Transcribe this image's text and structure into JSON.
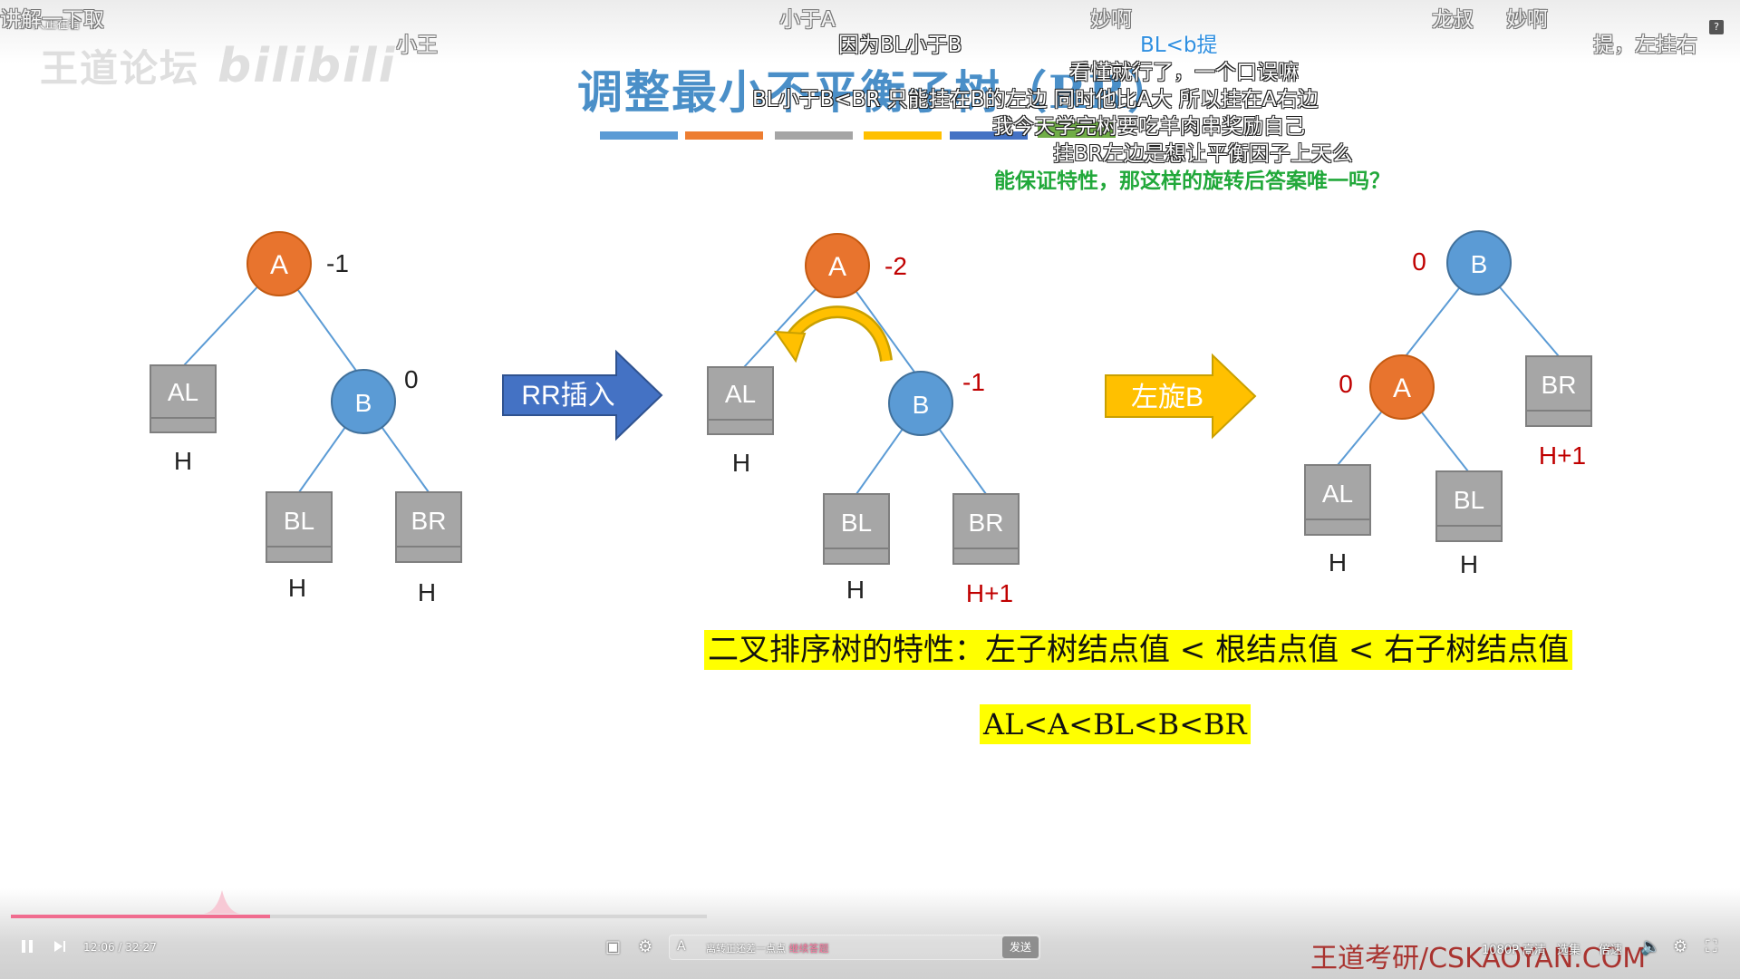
{
  "player": {
    "viewer_count": "24人正在看",
    "watermark_text": "王道论坛",
    "watermark_brand": "bilibili",
    "help": "?",
    "time": "12:06 / 32:27",
    "progress_fraction": 0.373,
    "danmaku_input_placeholder": "离转正还差一点点",
    "danmaku_input_link": "继续答题",
    "send_label": "发送",
    "brand_footer": "王道考研/CSKAOYAN.COM",
    "quality_label": "1080P 高清",
    "episodes_label": "选集",
    "speed_label": "倍速"
  },
  "danmaku": [
    {
      "text": "讲解一下取",
      "style": "faint",
      "cls": "d1"
    },
    {
      "text": "小王",
      "style": "faint",
      "cls": "d2"
    },
    {
      "text": "小于A",
      "style": "faint",
      "cls": "d3"
    },
    {
      "text": "因为BL小于B",
      "style": "normal",
      "cls": "d4"
    },
    {
      "text": "妙啊",
      "style": "faint",
      "cls": "d5"
    },
    {
      "text": "BL<b提",
      "style": "blue",
      "cls": "d6"
    },
    {
      "text": "龙叔",
      "style": "faint",
      "cls": "d7"
    },
    {
      "text": "妙啊",
      "style": "faint",
      "cls": "d8"
    },
    {
      "text": "提，左挂右",
      "style": "faint",
      "cls": "d9"
    },
    {
      "text": "看懂就行了，一个口误嘛",
      "style": "normal",
      "cls": "d10"
    },
    {
      "text": "BL小于B<BR 只能挂在B的左边 同时他比A大  所以挂在A右边",
      "style": "normal",
      "cls": "d11"
    },
    {
      "text": "我今天学完树要吃羊肉串奖励自己",
      "style": "normal",
      "cls": "d12"
    },
    {
      "text": "挂BR左边是想让平衡因子上天么",
      "style": "normal",
      "cls": "d13"
    },
    {
      "text": "能保证特性，那这样的旋转后答案唯一吗？",
      "style": "green",
      "cls": "d14"
    }
  ],
  "slide": {
    "title": "调整最小不平衡子树（RR）",
    "colors": {
      "node_orange": "#e8742e",
      "node_blue": "#5b9bd5",
      "box_gray": "#a6a6a6",
      "arrow_blue": "#4472c4",
      "arrow_yellow": "#ffc000",
      "red_text": "#c00000",
      "bar_colors": [
        "#5b9bd5",
        "#ed7d31",
        "#a5a5a5",
        "#ffc000",
        "#4472c4",
        "#70ad47"
      ]
    },
    "tree1": {
      "A": {
        "label": "A",
        "bf": "-1"
      },
      "B": {
        "label": "B",
        "bf": "0"
      },
      "AL": {
        "label": "AL",
        "h": "H"
      },
      "BL": {
        "label": "BL",
        "h": "H"
      },
      "BR": {
        "label": "BR",
        "h": "H"
      }
    },
    "arrow1": "RR插入",
    "tree2": {
      "A": {
        "label": "A",
        "bf": "-2"
      },
      "B": {
        "label": "B",
        "bf": "-1"
      },
      "AL": {
        "label": "AL",
        "h": "H"
      },
      "BL": {
        "label": "BL",
        "h": "H"
      },
      "BR": {
        "label": "BR",
        "h": "H+1"
      }
    },
    "arrow2": "左旋B",
    "tree3": {
      "B": {
        "label": "B",
        "bf": "0"
      },
      "A": {
        "label": "A",
        "bf": "0"
      },
      "AL": {
        "label": "AL",
        "h": "H"
      },
      "BL": {
        "label": "BL",
        "h": "H"
      },
      "BR": {
        "label": "BR",
        "h": "H+1"
      }
    },
    "note1": "二叉排序树的特性：左子树结点值 < 根结点值 < 右子树结点值",
    "note2": "AL<A<BL<B<BR"
  }
}
